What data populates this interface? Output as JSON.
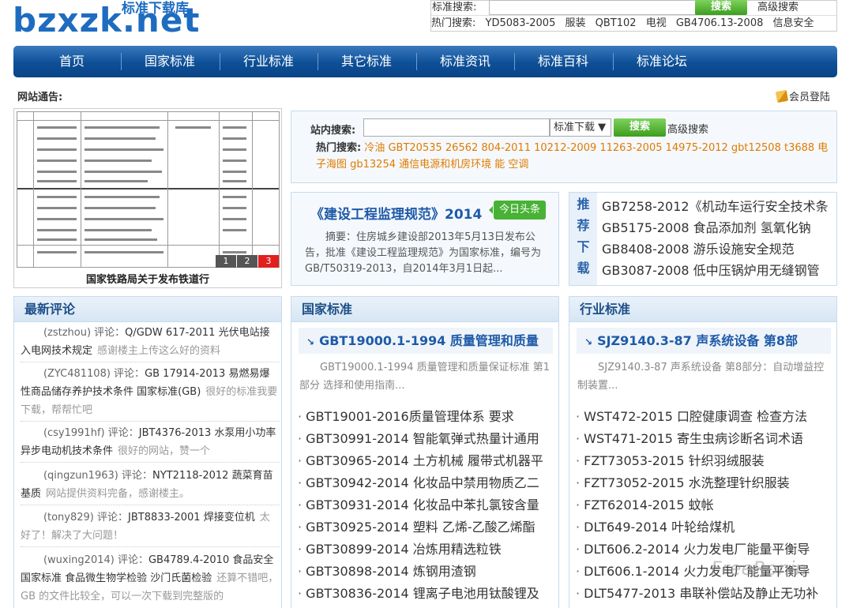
{
  "header": {
    "logo_text": "bzxzk.net",
    "logo_sub": "标准下载库"
  },
  "top_search": {
    "label": "标准搜索:",
    "button": "搜索",
    "advanced": "高级搜索",
    "hot_label": "热门搜索:",
    "hot": [
      "YD5083-2005",
      "服装",
      "QBT102",
      "电视",
      "GB4706.13-2008",
      "信息安全"
    ]
  },
  "nav": [
    "首页",
    "国家标准",
    "行业标准",
    "其它标准",
    "标准资讯",
    "标准百科",
    "标准论坛"
  ],
  "notice_label": "网站通告:",
  "login_label": "会员登陆",
  "slide": {
    "caption": "国家铁路局关于发布铁道行",
    "pages": [
      "1",
      "2",
      "3"
    ]
  },
  "site_search": {
    "label": "站内搜索:",
    "select": "标准下载",
    "button": "搜索",
    "advanced": "高级搜索",
    "hot_label": "热门搜索:",
    "hot": "冷油 GBT20535 26562 804-2011 10212-2009 11263-2005 14975-2012 gbt12508 t3688 电子海图 gb13254 通信电源和机房环境 能 空调"
  },
  "headline": {
    "title": "《建设工程监理规范》2014",
    "tag": "今日头条",
    "desc": "摘要：住房城乡建设部2013年5月13日发布公告，批准《建设工程监理规范》为国家标准，编号为GB/T50319-2013，自2014年3月1日起..."
  },
  "recommend": {
    "side": [
      "推",
      "荐",
      "下",
      "载"
    ],
    "items": [
      "GB7258-2012《机动车运行安全技术条",
      "GB5175-2008 食品添加剂 氢氧化钠",
      "GB8408-2008 游乐设施安全规范",
      "GB3087-2008 低中压锅炉用无缝钢管"
    ]
  },
  "comments": {
    "title": "最新评论",
    "items": [
      {
        "user": "(zstzhou) 评论：",
        "topic": "Q/GDW 617-2011 光伏电站接入电网技术规定",
        "text": "感谢楼主上传这么好的资料"
      },
      {
        "user": "(ZYC481108) 评论：",
        "topic": "GB 17914-2013 易燃易爆性商品储存养护技术条件 国家标准(GB)",
        "text": "很好的标准我要下载，帮帮忙吧"
      },
      {
        "user": "(csy1991hf) 评论：",
        "topic": "JBT4376-2013 水泵用小功率异步电动机技术条件",
        "text": "很好的网站，赞一个"
      },
      {
        "user": "(qingzun1963) 评论：",
        "topic": "NYT2118-2012 蔬菜育苗基质",
        "text": "网站提供资料完备，感谢楼主。"
      },
      {
        "user": "(tony829) 评论：",
        "topic": "JBT8833-2001 焊接变位机",
        "text": "太好了！解决了大问题！"
      },
      {
        "user": "(wuxing2014) 评论：",
        "topic": "GB4789.4-2010 食品安全国家标准 食品微生物学检验 沙门氏菌检验",
        "text": "还算不错吧，GB 的文件比较全，可以一次下载到完整版的"
      }
    ]
  },
  "national": {
    "title": "国家标准",
    "feature": "GBT19000.1-1994 质量管理和质量",
    "feature_desc": "GBT19000.1-1994 质量管理和质量保证标准 第1部分 选择和使用指南...",
    "items": [
      "GBT19001-2016质量管理体系 要求",
      "GBT30991-2014 智能氧弹式热量计通用",
      "GBT30965-2014 土方机械 履带式机器平",
      "GBT30942-2014 化妆品中禁用物质乙二",
      "GBT30931-2014 化妆品中苯扎氯铵含量",
      "GBT30925-2014 塑料 乙烯-乙酸乙烯酯",
      "GBT30899-2014 冶炼用精选粒铁",
      "GBT30898-2014 炼钢用渣钢",
      "GBT30836-2014 锂离子电池用钛酸锂及"
    ]
  },
  "industry": {
    "title": "行业标准",
    "feature": "SJZ9140.3-87 声系统设备 第8部",
    "feature_desc": "SJZ9140.3-87 声系统设备 第8部分：自动增益控制装置...",
    "items": [
      "WST472-2015 口腔健康调查 检查方法",
      "WST471-2015 寄生虫病诊断名词术语",
      "FZT73053-2015 针织羽绒服装",
      "FZT73052-2015 水洗整理针织服装",
      "FZT62014-2015 蚊帐",
      "DLT649-2014 叶轮给煤机",
      "DLT606.2-2014 火力发电厂能量平衡导",
      "DLT606.1-2014 火力发电厂能量平衡导",
      "DLT5477-2013 串联补偿站及静止无功补"
    ]
  },
  "watermark": "FreeRonin"
}
